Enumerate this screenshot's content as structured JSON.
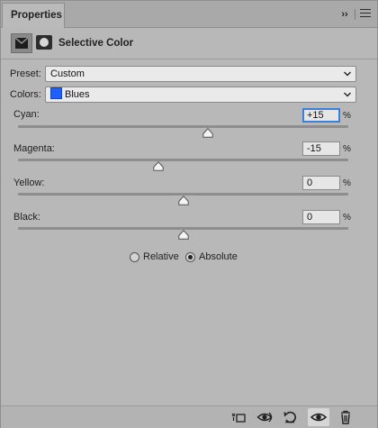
{
  "panel": {
    "tab_label": "Properties",
    "collapse_label": "››"
  },
  "header": {
    "title": "Selective Color"
  },
  "preset": {
    "label": "Preset:",
    "value": "Custom"
  },
  "colors": {
    "label": "Colors:",
    "value": "Blues",
    "swatch_color": "#1f5eff"
  },
  "sliders": [
    {
      "label": "Cyan:",
      "value": "+15",
      "unit": "%",
      "level": 0.575
    },
    {
      "label": "Magenta:",
      "value": "-15",
      "unit": "%",
      "level": 0.425
    },
    {
      "label": "Yellow:",
      "value": "0",
      "unit": "%",
      "level": 0.5
    },
    {
      "label": "Black:",
      "value": "0",
      "unit": "%",
      "level": 0.5
    }
  ],
  "method": {
    "relative_label": "Relative",
    "absolute_label": "Absolute",
    "selected": "Absolute"
  },
  "footer_icons": [
    "clip-to-layer-icon",
    "view-previous-state-icon",
    "reset-icon",
    "toggle-visibility-icon",
    "delete-icon"
  ]
}
